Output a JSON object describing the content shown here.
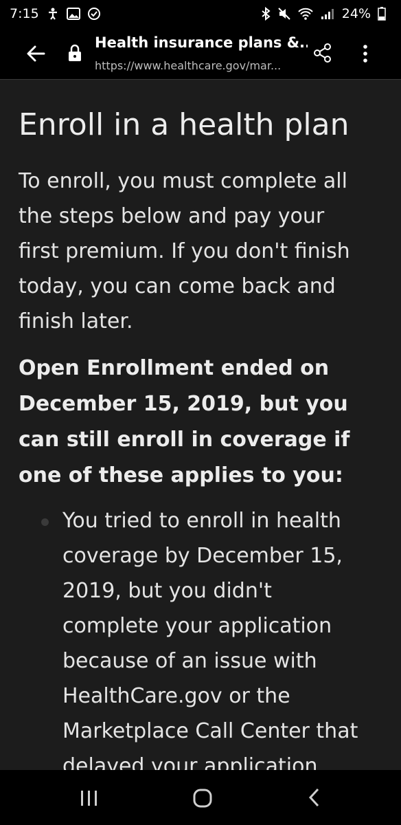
{
  "status_bar": {
    "time": "7:15",
    "battery": "24%",
    "left_icons": [
      "accessibility-icon",
      "image-icon",
      "check-circle-icon"
    ],
    "right_icons": [
      "bluetooth-icon",
      "mute-icon",
      "wifi-icon",
      "signal-icon",
      "battery-icon"
    ]
  },
  "toolbar": {
    "page_title": "Health insurance plans &...",
    "url": "https://www.healthcare.gov/mar..."
  },
  "main": {
    "heading": "Enroll in a health plan",
    "intro_lines": [
      "To enroll, you must complete all",
      "the steps below and pay your",
      "first premium. If you don't finish",
      "today, you can come back and",
      "finish later."
    ],
    "notice_lines": [
      "Open Enrollment ended on",
      "December 15, 2019, but you",
      "can still enroll in coverage if",
      "one of these applies to you:"
    ],
    "bullet_lines": [
      "You tried to enroll in health",
      "coverage by December 15,",
      "2019, but you didn't",
      "complete your application",
      "because of an issue with",
      "HealthCare.gov or the",
      "Marketplace Call Center that",
      "delayed your application"
    ]
  },
  "colors": {
    "background": "#1c1c1c",
    "bars": "#000000",
    "text": "#e6e6e6"
  }
}
